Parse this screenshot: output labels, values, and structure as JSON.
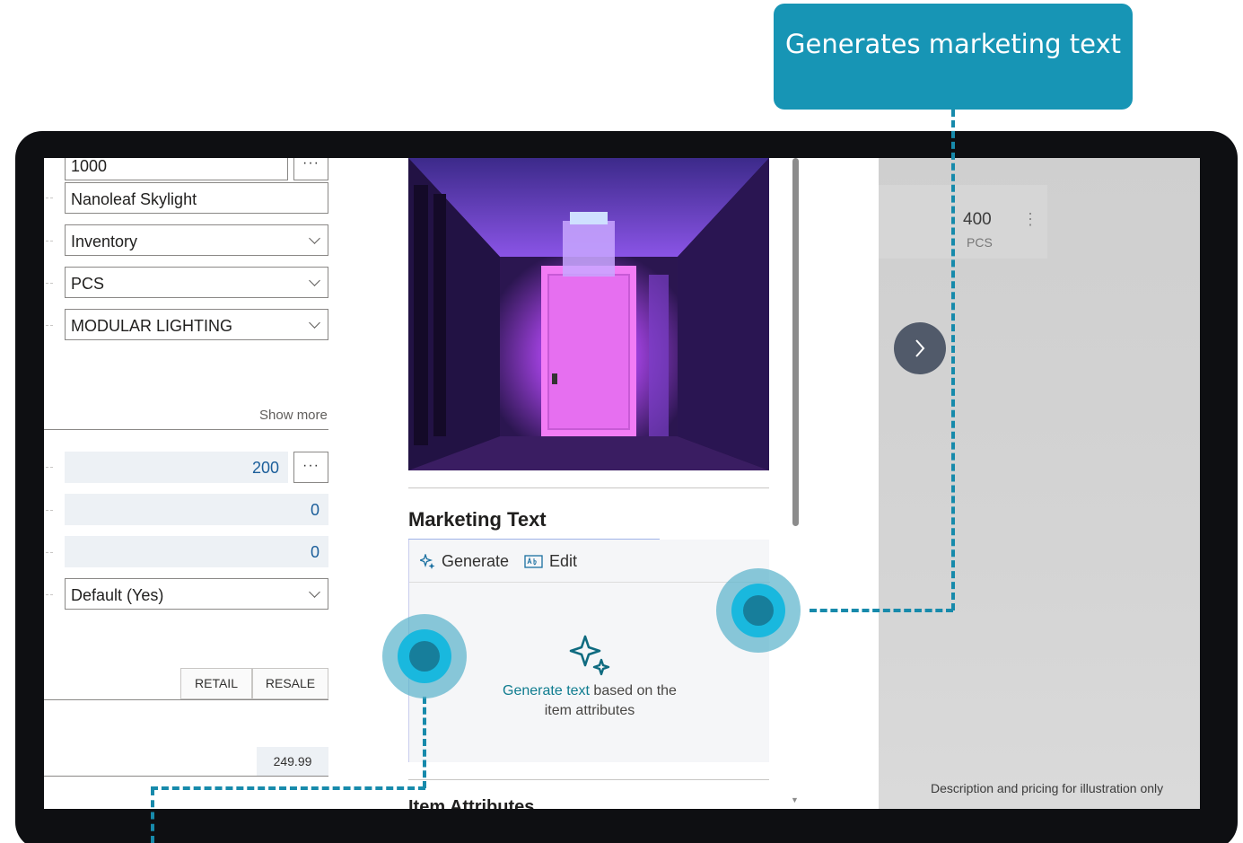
{
  "callout": {
    "text": "Generates marketing text"
  },
  "form": {
    "no_value": "1000",
    "description": "Nanoleaf Skylight",
    "type": "Inventory",
    "unit": "PCS",
    "category": "MODULAR LIGHTING",
    "show_more": "Show more",
    "inventory": "200",
    "qty_field_2": "0",
    "qty_field_3": "0",
    "default_select": "Default (Yes)",
    "segment_retail": "RETAIL",
    "segment_resale": "RESALE",
    "price": "249.99",
    "dots": "···"
  },
  "marketing": {
    "title": "Marketing Text",
    "generate": "Generate",
    "edit": "Edit",
    "empty_link": "Generate text",
    "empty_rest1": " based on the",
    "empty_rest2": "item attributes",
    "next_section": "Item Attributes"
  },
  "right": {
    "qty": "400",
    "unit": "PCS",
    "disclaimer": "Description and pricing for illustration only"
  },
  "colors": {
    "callout": "#1795b5",
    "hotspot": "#19b8de",
    "accent_link": "#0f7c8f"
  }
}
